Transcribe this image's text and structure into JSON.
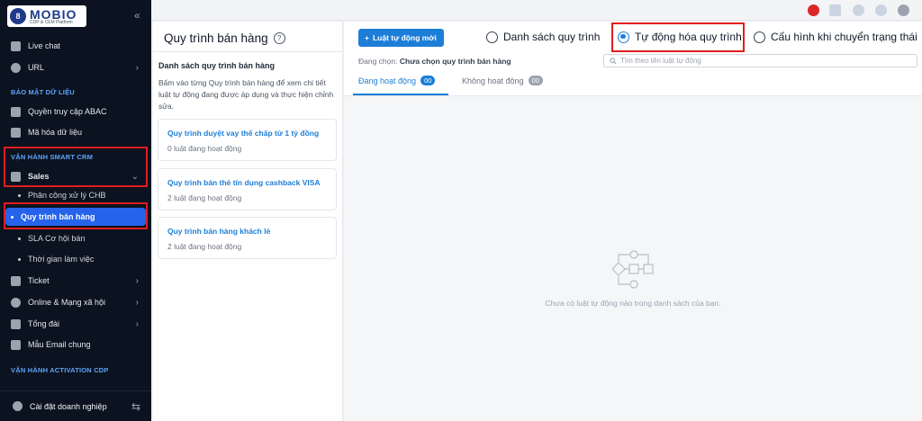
{
  "sidebar": {
    "logo_name": "MOBIO",
    "logo_sub": "CDP & CEM Platform",
    "items": {
      "live_chat": "Live chat",
      "url": "URL",
      "section_security": "BẢO MẬT DỮ LIỆU",
      "abac": "Quyền truy cập ABAC",
      "encrypt": "Mã hóa dữ liệu",
      "section_crm": "VẬN HÀNH SMART CRM",
      "sales": "Sales",
      "assign": "Phân công xử lý CHB",
      "sales_process": "Quy trình bán hàng",
      "sla": "SLA Cơ hội bán",
      "worktime": "Thời gian làm việc",
      "ticket": "Ticket",
      "online": "Online & Mạng xã hội",
      "callcenter": "Tổng đài",
      "email": "Mẫu Email chung",
      "section_cdp": "VẬN HÀNH ACTIVATION CDP"
    },
    "footer": "Cài đặt doanh nghiệp"
  },
  "panel": {
    "title": "Quy trình bán hàng",
    "list_heading": "Danh sách quy trình bán hàng",
    "list_description": "Bấm vào từng Quy trình bán hàng để xem chi tiết luật tự động đang được áp dụng và thực hiện chỉnh sửa.",
    "cards": [
      {
        "title": "Quy trình duyệt vay thế chấp từ 1 tỷ đồng",
        "sub": "0 luật đang hoạt động"
      },
      {
        "title": "Quy trình bán thẻ tín dụng cashback VISA",
        "sub": "2 luật đang hoạt động"
      },
      {
        "title": "Quy trình bán hàng khách lẻ",
        "sub": "2 luật đang hoạt động"
      }
    ]
  },
  "main": {
    "add_button": "Luật tự động mới",
    "radios": {
      "list": "Danh sách quy trình",
      "automation": "Tự động hóa quy trình",
      "status_config": "Cấu hình khi chuyển trạng thái"
    },
    "selected_label": "Đang chọn:",
    "selected_value": "Chưa chọn quy trình bán hàng",
    "search_placeholder": "Tìm theo tên luật tự động",
    "tabs": {
      "active_label": "Đang hoạt động",
      "active_count": "00",
      "inactive_label": "Không hoạt động",
      "inactive_count": "00"
    },
    "empty_text": "Chưa có luật tự động nào trong danh sách của bạn."
  },
  "colors": {
    "accent": "#1d7ed8",
    "sidebar_bg": "#0b1220",
    "highlight": "#e11d1d"
  }
}
